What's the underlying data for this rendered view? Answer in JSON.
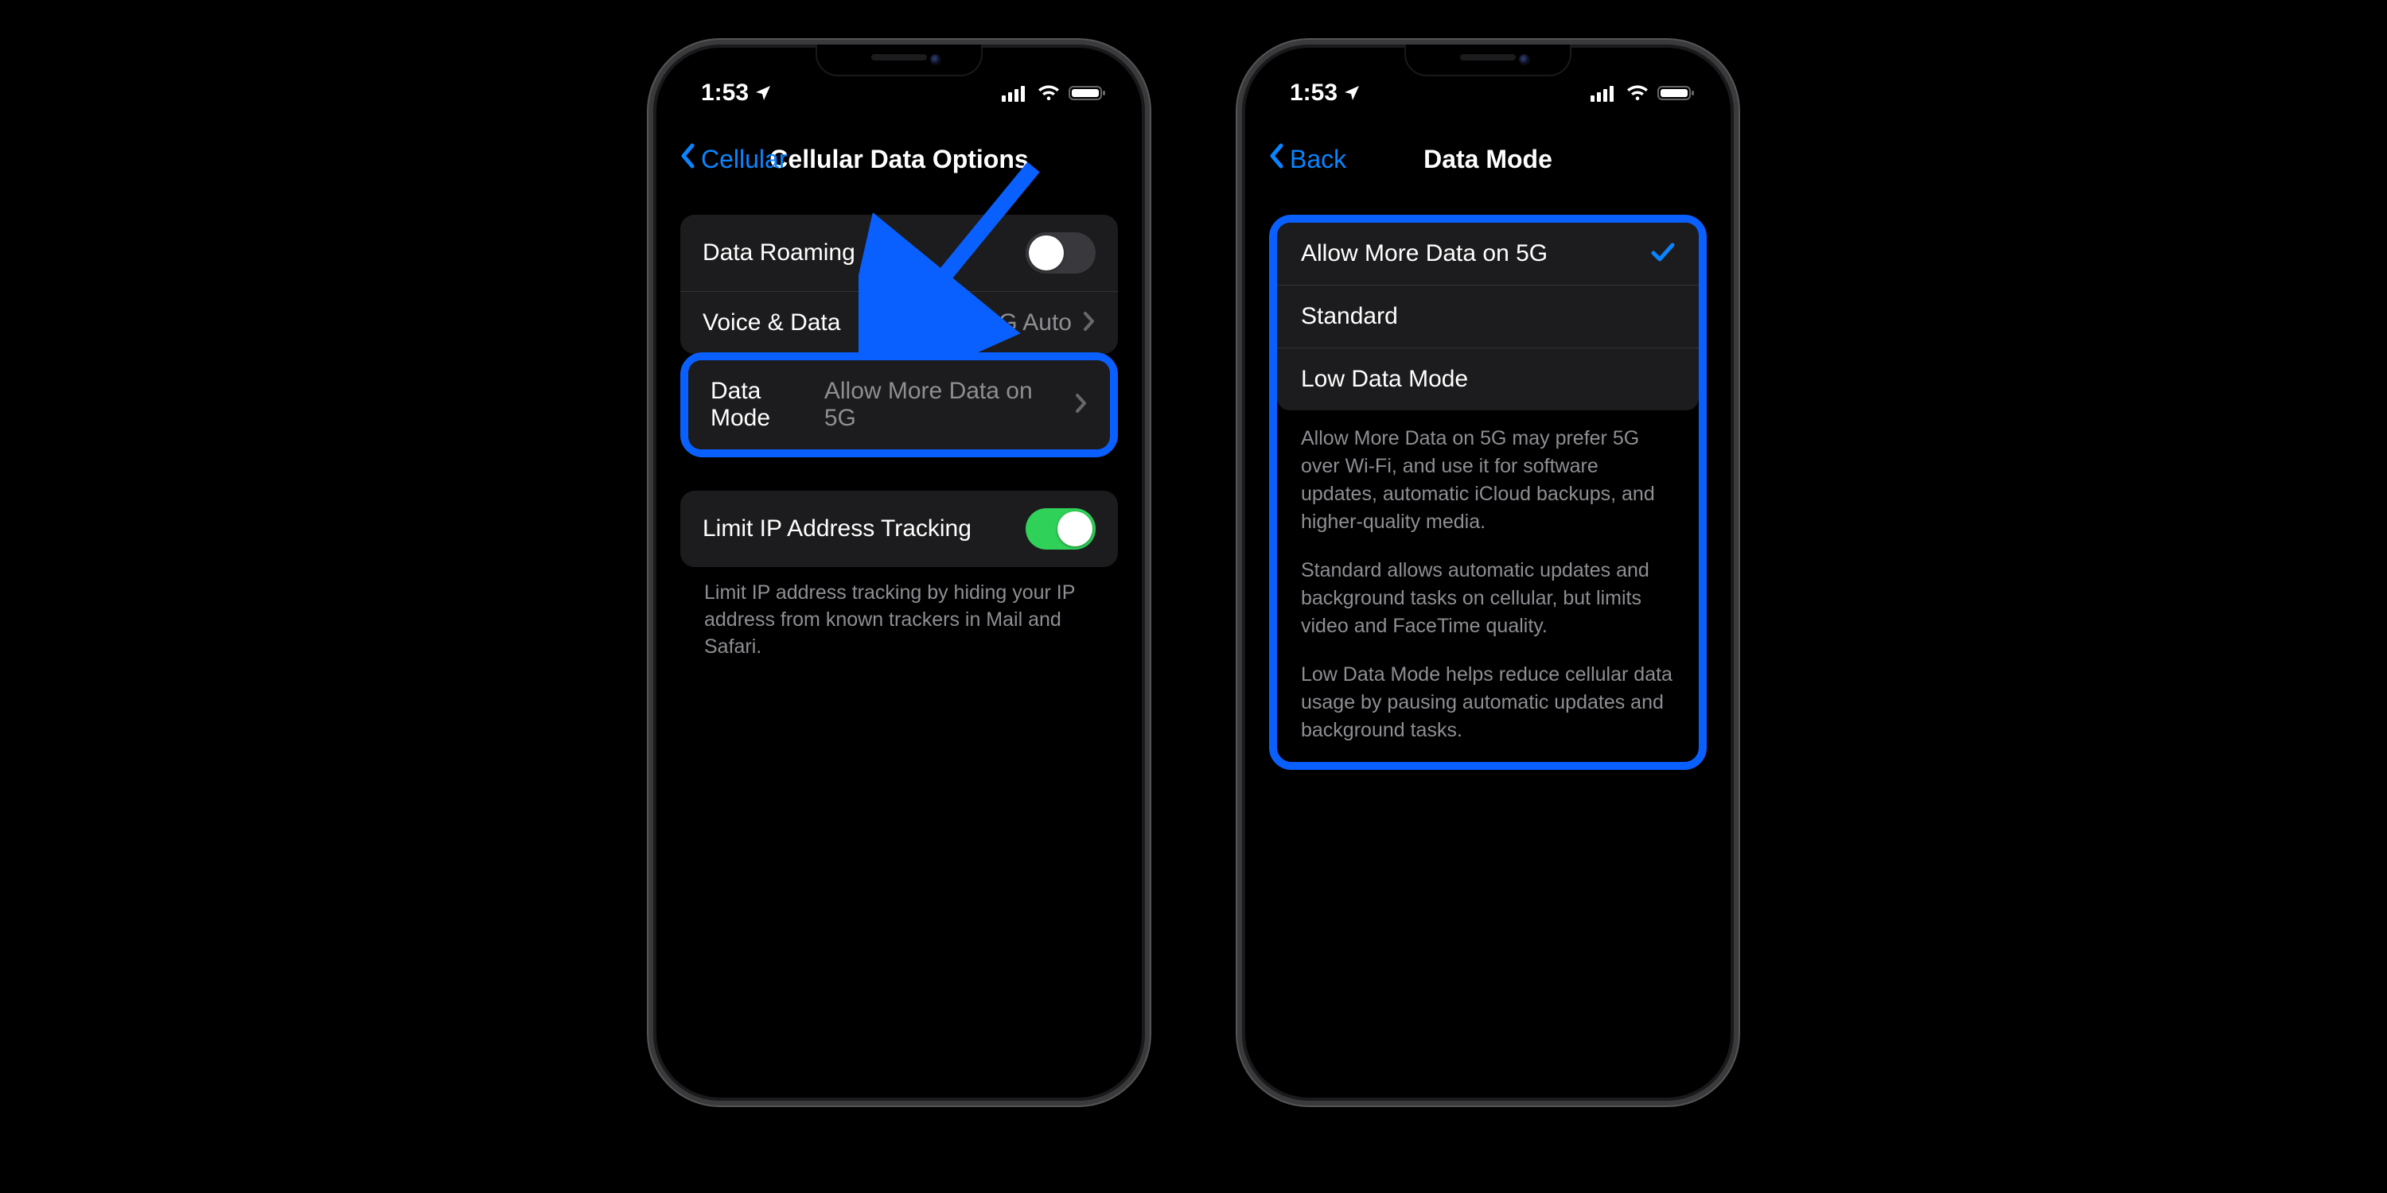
{
  "status": {
    "time": "1:53"
  },
  "left_phone": {
    "back_label": "Cellular",
    "title": "Cellular Data Options",
    "rows": {
      "data_roaming": "Data Roaming",
      "voice_data_label": "Voice & Data",
      "voice_data_value": "5G Auto",
      "data_mode_label": "Data Mode",
      "data_mode_value": "Allow More Data on 5G",
      "limit_ip_label": "Limit IP Address Tracking"
    },
    "footer": "Limit IP address tracking by hiding your IP address from known trackers in Mail and Safari."
  },
  "right_phone": {
    "back_label": "Back",
    "title": "Data Mode",
    "options": {
      "opt1": "Allow More Data on 5G",
      "opt2": "Standard",
      "opt3": "Low Data Mode"
    },
    "desc": {
      "p1": "Allow More Data on 5G may prefer 5G over Wi-Fi, and use it for software updates, automatic iCloud backups, and higher-quality media.",
      "p2": "Standard allows automatic updates and background tasks on cellular, but limits video and FaceTime quality.",
      "p3": "Low Data Mode helps reduce cellular data usage by pausing automatic updates and background tasks."
    }
  }
}
